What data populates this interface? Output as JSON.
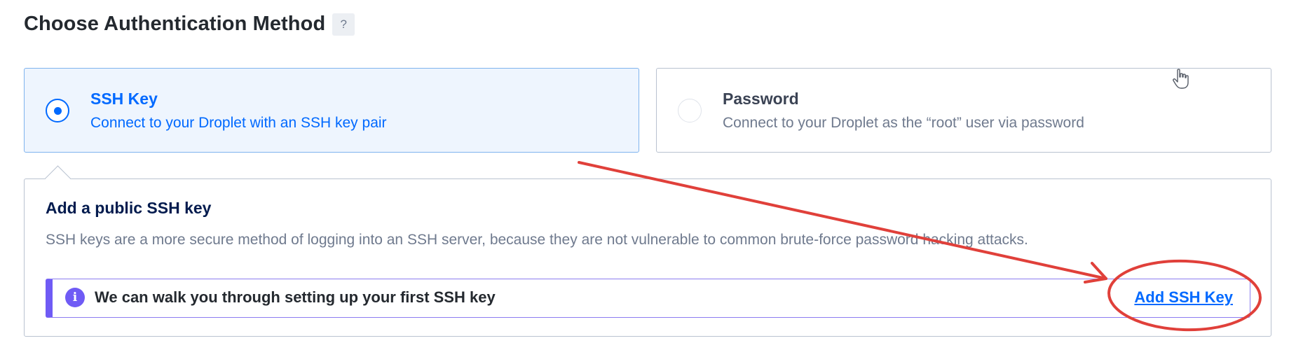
{
  "header": {
    "title": "Choose Authentication Method",
    "help_label": "?"
  },
  "options": [
    {
      "title": "SSH Key",
      "description": "Connect to your Droplet with an SSH key pair",
      "selected": true
    },
    {
      "title": "Password",
      "description": "Connect to your Droplet as the “root” user via password",
      "selected": false
    }
  ],
  "ssh_panel": {
    "title": "Add a public SSH key",
    "description": "SSH keys are a more secure method of logging into an SSH server, because they are not vulnerable to common brute-force password hacking attacks.",
    "info": {
      "icon": "info-icon",
      "icon_glyph": "i",
      "message": "We can walk you through setting up your first SSH key",
      "action_label": "Add SSH Key"
    }
  },
  "annotation": {
    "color": "#e0403a"
  },
  "colors": {
    "accent": "#0069ff",
    "info": "#6f5bf5",
    "text": "#031b4e"
  }
}
